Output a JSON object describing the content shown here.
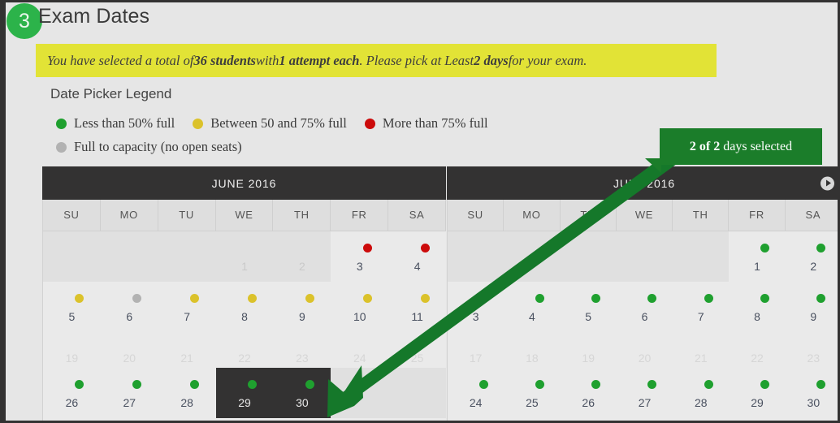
{
  "step": {
    "number": "3",
    "title": "Exam Dates"
  },
  "notice": {
    "pre": "You have selected a total of ",
    "students": "36 students",
    "mid1": " with ",
    "attempts": "1 attempt each",
    "mid2": ". Please pick at Least ",
    "days": "2 days",
    "post": " for your exam."
  },
  "legend": {
    "title": "Date Picker Legend",
    "items": [
      {
        "color": "green",
        "label": "Less than 50% full"
      },
      {
        "color": "yellow",
        "label": "Between 50 and 75% full"
      },
      {
        "color": "red",
        "label": "More than 75% full"
      },
      {
        "color": "grey",
        "label": "Full to capacity (no open seats)"
      }
    ]
  },
  "callout": {
    "count": "2 of 2",
    "suffix": " days selected"
  },
  "colors": {
    "green": "#1fa02f",
    "yellow": "#dbc22b",
    "red": "#cc0b0b",
    "grey": "#b2b2b2",
    "accent_green": "#2cb34a",
    "callout_green": "#1b7d2a",
    "notice_yellow": "#e2e336",
    "dark": "#333232"
  },
  "calendars": [
    {
      "name": "june",
      "title": "JUNE 2016",
      "has_next": false,
      "dow": [
        "SU",
        "MO",
        "TU",
        "WE",
        "TH",
        "FR",
        "SA"
      ],
      "weeks": [
        {
          "fade": false,
          "cells": [
            {
              "num": "",
              "state": "blank",
              "dot": ""
            },
            {
              "num": "",
              "state": "blank",
              "dot": ""
            },
            {
              "num": "",
              "state": "blank",
              "dot": ""
            },
            {
              "num": "1",
              "state": "muted",
              "dot": ""
            },
            {
              "num": "2",
              "state": "muted",
              "dot": ""
            },
            {
              "num": "3",
              "state": "normal",
              "dot": "red"
            },
            {
              "num": "4",
              "state": "normal",
              "dot": "red"
            }
          ]
        },
        {
          "fade": false,
          "cells": [
            {
              "num": "5",
              "state": "normal",
              "dot": "yellow"
            },
            {
              "num": "6",
              "state": "normal",
              "dot": "grey"
            },
            {
              "num": "7",
              "state": "normal",
              "dot": "yellow"
            },
            {
              "num": "8",
              "state": "normal",
              "dot": "yellow"
            },
            {
              "num": "9",
              "state": "normal",
              "dot": "yellow"
            },
            {
              "num": "10",
              "state": "normal",
              "dot": "yellow"
            },
            {
              "num": "11",
              "state": "normal",
              "dot": "yellow"
            }
          ]
        },
        {
          "fade": true,
          "cells": [
            {
              "num": "19",
              "state": "faded",
              "dot": ""
            },
            {
              "num": "20",
              "state": "faded",
              "dot": ""
            },
            {
              "num": "21",
              "state": "faded",
              "dot": ""
            },
            {
              "num": "22",
              "state": "faded",
              "dot": ""
            },
            {
              "num": "23",
              "state": "faded",
              "dot": ""
            },
            {
              "num": "24",
              "state": "faded",
              "dot": ""
            },
            {
              "num": "25",
              "state": "faded",
              "dot": ""
            }
          ]
        },
        {
          "fade": false,
          "cells": [
            {
              "num": "26",
              "state": "normal",
              "dot": "green"
            },
            {
              "num": "27",
              "state": "normal",
              "dot": "green"
            },
            {
              "num": "28",
              "state": "normal",
              "dot": "green"
            },
            {
              "num": "29",
              "state": "selected",
              "dot": "green"
            },
            {
              "num": "30",
              "state": "selected",
              "dot": "green"
            },
            {
              "num": "",
              "state": "trail",
              "dot": ""
            },
            {
              "num": "",
              "state": "trail",
              "dot": ""
            }
          ]
        }
      ]
    },
    {
      "name": "july",
      "title": "JULY 2016",
      "has_next": true,
      "dow": [
        "SU",
        "MO",
        "TU",
        "WE",
        "TH",
        "FR",
        "SA"
      ],
      "weeks": [
        {
          "fade": false,
          "cells": [
            {
              "num": "",
              "state": "blank",
              "dot": ""
            },
            {
              "num": "",
              "state": "blank",
              "dot": ""
            },
            {
              "num": "",
              "state": "blank",
              "dot": ""
            },
            {
              "num": "",
              "state": "blank",
              "dot": ""
            },
            {
              "num": "",
              "state": "blank",
              "dot": ""
            },
            {
              "num": "1",
              "state": "normal",
              "dot": "green"
            },
            {
              "num": "2",
              "state": "normal",
              "dot": "green"
            }
          ]
        },
        {
          "fade": false,
          "cells": [
            {
              "num": "3",
              "state": "normal",
              "dot": "green"
            },
            {
              "num": "4",
              "state": "normal",
              "dot": "green"
            },
            {
              "num": "5",
              "state": "normal",
              "dot": "green"
            },
            {
              "num": "6",
              "state": "normal",
              "dot": "green"
            },
            {
              "num": "7",
              "state": "normal",
              "dot": "green"
            },
            {
              "num": "8",
              "state": "normal",
              "dot": "green"
            },
            {
              "num": "9",
              "state": "normal",
              "dot": "green"
            }
          ]
        },
        {
          "fade": true,
          "cells": [
            {
              "num": "17",
              "state": "faded",
              "dot": ""
            },
            {
              "num": "18",
              "state": "faded",
              "dot": ""
            },
            {
              "num": "19",
              "state": "faded",
              "dot": ""
            },
            {
              "num": "20",
              "state": "faded",
              "dot": ""
            },
            {
              "num": "21",
              "state": "faded",
              "dot": ""
            },
            {
              "num": "22",
              "state": "faded",
              "dot": ""
            },
            {
              "num": "23",
              "state": "faded",
              "dot": ""
            }
          ]
        },
        {
          "fade": false,
          "cells": [
            {
              "num": "24",
              "state": "normal",
              "dot": "green"
            },
            {
              "num": "25",
              "state": "normal",
              "dot": "green"
            },
            {
              "num": "26",
              "state": "normal",
              "dot": "green"
            },
            {
              "num": "27",
              "state": "normal",
              "dot": "green"
            },
            {
              "num": "28",
              "state": "normal",
              "dot": "green"
            },
            {
              "num": "29",
              "state": "normal",
              "dot": "green"
            },
            {
              "num": "30",
              "state": "normal",
              "dot": "green"
            }
          ]
        }
      ]
    }
  ]
}
